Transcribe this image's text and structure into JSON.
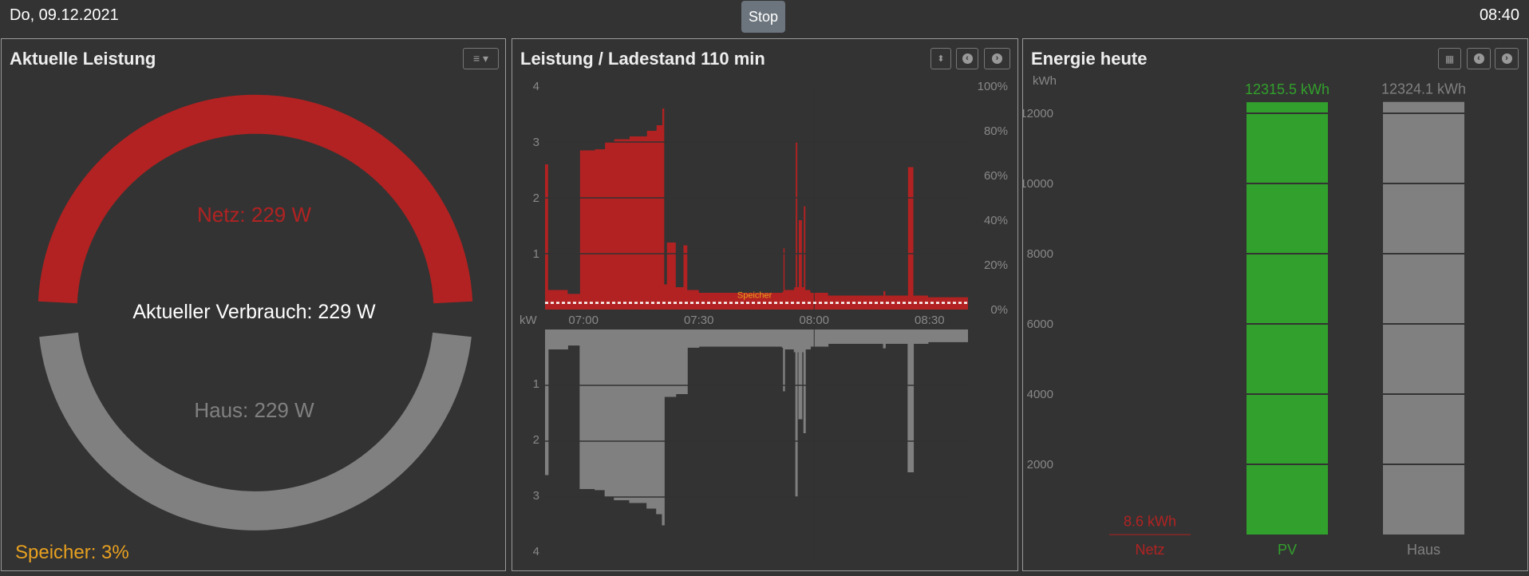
{
  "header": {
    "date": "Do, 09.12.2021",
    "stop_label": "Stop",
    "time": "08:40"
  },
  "colors": {
    "netz": "#b22222",
    "pv": "#32a02c",
    "haus": "#808080",
    "speicher": "#e8a020",
    "background": "#333333"
  },
  "gauge": {
    "title": "Aktuelle Leistung",
    "menu_icon": "menu-dropdown-icon",
    "netz_label": "Netz: 229 W",
    "verbrauch_label": "Aktueller Verbrauch: 229 W",
    "haus_label": "Haus: 229 W",
    "speicher_label": "Speicher: 3%",
    "netz_w": 229,
    "haus_w": 229,
    "speicher_pct": 3
  },
  "power_chart": {
    "title": "Leistung / Ladestand 110 min",
    "buttons": [
      "sort-icon",
      "chevron-left-icon",
      "chevron-right-icon"
    ],
    "speicher_series_label": "Speicher",
    "chart_data": {
      "type": "area",
      "x_range": [
        "06:50:00",
        "08:40:00"
      ],
      "x_ticks": [
        "07:00",
        "07:30",
        "08:00",
        "08:30"
      ],
      "y_unit": "kW",
      "y_ticks_top": [
        "1",
        "2",
        "3",
        "4"
      ],
      "y_ticks_bottom": [
        "1",
        "2",
        "3",
        "4"
      ],
      "y_range_kw": [
        0,
        4
      ],
      "y2_ticks": [
        "0%",
        "20%",
        "40%",
        "60%",
        "80%",
        "100%"
      ],
      "speicher_pct": 3,
      "netz_kw": [
        [
          "06:50:00",
          2.6
        ],
        [
          "06:50:48",
          0.35
        ],
        [
          "06:55:54",
          0.28
        ],
        [
          "06:59:06",
          2.85
        ],
        [
          "07:03:00",
          2.87
        ],
        [
          "07:05:36",
          3.0
        ],
        [
          "07:08:00",
          3.05
        ],
        [
          "07:12:00",
          3.1
        ],
        [
          "07:16:30",
          3.2
        ],
        [
          "07:19:00",
          3.3
        ],
        [
          "07:20:30",
          3.6
        ],
        [
          "07:21:00",
          0.45
        ],
        [
          "07:21:42",
          1.2
        ],
        [
          "07:24:00",
          0.4
        ],
        [
          "07:26:00",
          1.15
        ],
        [
          "07:27:00",
          0.35
        ],
        [
          "07:30:00",
          0.3
        ],
        [
          "07:51:42",
          0.32
        ],
        [
          "07:52:00",
          1.1
        ],
        [
          "07:52:18",
          0.35
        ],
        [
          "07:54:48",
          0.4
        ],
        [
          "07:55:12",
          3.0
        ],
        [
          "07:55:36",
          0.4
        ],
        [
          "07:56:00",
          1.6
        ],
        [
          "07:56:48",
          0.4
        ],
        [
          "07:57:18",
          1.85
        ],
        [
          "07:57:42",
          0.35
        ],
        [
          "07:59:00",
          0.3
        ],
        [
          "08:03:36",
          0.25
        ],
        [
          "08:18:00",
          0.33
        ],
        [
          "08:18:30",
          0.25
        ],
        [
          "08:24:24",
          2.55
        ],
        [
          "08:25:48",
          0.25
        ],
        [
          "08:29:36",
          0.22
        ],
        [
          "08:40:00",
          0.22
        ]
      ],
      "haus_kw": [
        [
          "06:50:00",
          2.6
        ],
        [
          "06:50:48",
          0.35
        ],
        [
          "06:55:54",
          0.28
        ],
        [
          "06:59:06",
          2.85
        ],
        [
          "07:03:00",
          2.87
        ],
        [
          "07:05:36",
          3.0
        ],
        [
          "07:08:00",
          3.05
        ],
        [
          "07:12:00",
          3.1
        ],
        [
          "07:16:30",
          3.2
        ],
        [
          "07:19:00",
          3.3
        ],
        [
          "07:20:30",
          3.5
        ],
        [
          "07:21:00",
          1.2
        ],
        [
          "07:24:00",
          1.15
        ],
        [
          "07:27:00",
          0.32
        ],
        [
          "07:30:00",
          0.3
        ],
        [
          "07:51:42",
          0.32
        ],
        [
          "07:52:00",
          1.1
        ],
        [
          "07:52:18",
          0.35
        ],
        [
          "07:54:48",
          0.4
        ],
        [
          "07:55:12",
          3.0
        ],
        [
          "07:55:36",
          0.4
        ],
        [
          "07:56:00",
          1.6
        ],
        [
          "07:56:48",
          0.4
        ],
        [
          "07:57:18",
          1.85
        ],
        [
          "07:57:42",
          0.35
        ],
        [
          "07:59:00",
          0.3
        ],
        [
          "08:03:36",
          0.25
        ],
        [
          "08:18:00",
          0.33
        ],
        [
          "08:18:30",
          0.25
        ],
        [
          "08:24:24",
          2.55
        ],
        [
          "08:25:48",
          0.25
        ],
        [
          "08:29:36",
          0.22
        ],
        [
          "08:40:00",
          0.22
        ]
      ]
    }
  },
  "energy_chart": {
    "title": "Energie heute",
    "buttons": [
      "calendar-icon",
      "chevron-left-icon",
      "chevron-right-icon"
    ],
    "chart_data": {
      "type": "bar",
      "y_unit": "kWh",
      "y_ticks": [
        "2000",
        "4000",
        "6000",
        "8000",
        "10000",
        "12000"
      ],
      "y_range": [
        0,
        12400
      ],
      "categories": [
        "Netz",
        "PV",
        "Haus"
      ],
      "values": [
        8.6,
        12315.5,
        12324.1
      ],
      "value_labels": [
        "8.6 kWh",
        "12315.5 kWh",
        "12324.1 kWh"
      ]
    }
  }
}
